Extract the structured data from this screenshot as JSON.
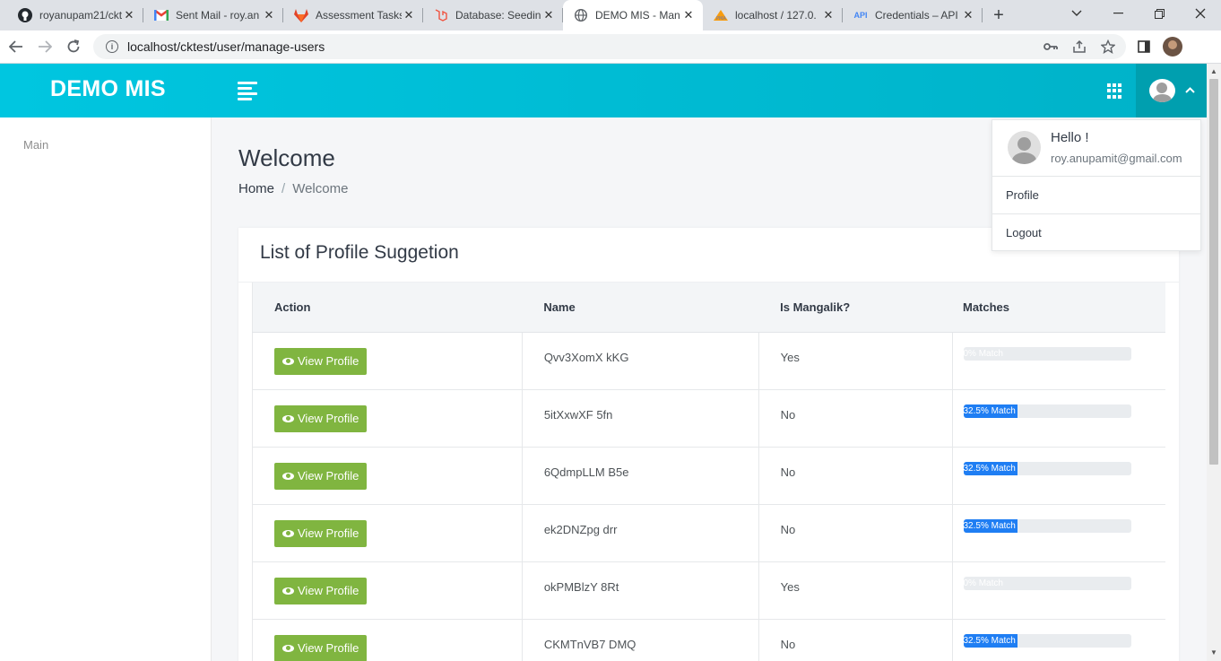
{
  "browser": {
    "tabs": [
      {
        "title": "royanupam21/ckt",
        "icon": "github-icon",
        "active": false
      },
      {
        "title": "Sent Mail - roy.an",
        "icon": "gmail-icon",
        "active": false
      },
      {
        "title": "Assessment Tasks",
        "icon": "gitlab-icon",
        "active": false
      },
      {
        "title": "Database: Seedin",
        "icon": "laravel-icon",
        "active": false
      },
      {
        "title": "DEMO MIS - Man",
        "icon": "globe-icon",
        "active": true
      },
      {
        "title": "localhost / 127.0.",
        "icon": "phpmyadmin-icon",
        "active": false
      },
      {
        "title": "Credentials – API",
        "icon": "api-icon",
        "active": false
      }
    ],
    "url": "localhost/cktest/user/manage-users"
  },
  "header": {
    "brand": "DEMO MIS"
  },
  "sidebar": {
    "section_label": "Main"
  },
  "page": {
    "title": "Welcome",
    "breadcrumb": {
      "home": "Home",
      "separator": "/",
      "current": "Welcome"
    }
  },
  "card": {
    "title": "List of Profile Suggetion",
    "columns": [
      "Action",
      "Name",
      "Is Mangalik?",
      "Matches"
    ],
    "button_label": "View Profile",
    "rows": [
      {
        "name": "Qvv3XomX kKG",
        "mangalik": "Yes",
        "match_label": "0% Match",
        "match_percent": 0
      },
      {
        "name": "5itXxwXF 5fn",
        "mangalik": "No",
        "match_label": "32.5% Match",
        "match_percent": 32.5
      },
      {
        "name": "6QdmpLLM B5e",
        "mangalik": "No",
        "match_label": "32.5% Match",
        "match_percent": 32.5
      },
      {
        "name": "ek2DNZpg drr",
        "mangalik": "No",
        "match_label": "32.5% Match",
        "match_percent": 32.5
      },
      {
        "name": "okPMBlzY 8Rt",
        "mangalik": "Yes",
        "match_label": "0% Match",
        "match_percent": 0
      },
      {
        "name": "CKMTnVB7 DMQ",
        "mangalik": "No",
        "match_label": "32.5% Match",
        "match_percent": 32.5
      }
    ]
  },
  "user_menu": {
    "greeting": "Hello !",
    "email": "roy.anupamit@gmail.com",
    "items": [
      "Profile",
      "Logout"
    ]
  },
  "colors": {
    "header_start": "#00c6e0",
    "header_end": "#00b2c8",
    "button_green": "#80b540",
    "progress_blue": "#1f7ef3"
  }
}
